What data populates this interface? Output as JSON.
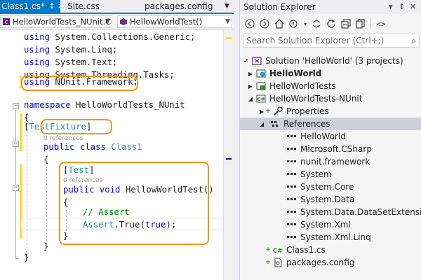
{
  "editor": {
    "tabs": [
      {
        "label": "Class1.cs*",
        "active": true
      },
      {
        "label": "Site.css",
        "active": false
      },
      {
        "label": "packages.config",
        "active": false
      }
    ],
    "navbar": {
      "project": "HelloWorldTests_NUnit.C",
      "member": "HellowWorldTest()"
    },
    "code": [
      {
        "parts": [
          [
            "kw",
            "using"
          ],
          [
            "",
            "System.Collections.Generic;"
          ]
        ]
      },
      {
        "parts": [
          [
            "kw",
            "using"
          ],
          [
            "",
            "System.Linq;"
          ]
        ]
      },
      {
        "parts": [
          [
            "kw",
            "using"
          ],
          [
            "",
            "System.Text;"
          ]
        ]
      },
      {
        "parts": [
          [
            "kw",
            "using"
          ],
          [
            "",
            "System.Threading.Tasks;"
          ]
        ]
      },
      {
        "parts": [
          [
            "kw",
            "using"
          ],
          [
            "",
            "NUnit.Framework;"
          ]
        ]
      },
      {
        "parts": []
      },
      {
        "parts": [
          [
            "kw",
            "namespace"
          ],
          [
            "",
            "HelloWorldTests_NUnit"
          ]
        ]
      },
      {
        "parts": [
          [
            "",
            "{"
          ]
        ]
      },
      {
        "parts": [
          [
            "",
            "["
          ],
          [
            "ty",
            "TestFixture"
          ],
          [
            "",
            "]"
          ]
        ]
      },
      {
        "parts": [
          [
            "kw",
            "public"
          ],
          [
            "kw",
            "class"
          ],
          [
            "ty",
            "Class1"
          ]
        ]
      },
      {
        "parts": [
          [
            "",
            "{"
          ]
        ]
      },
      {
        "parts": [
          [
            "",
            "["
          ],
          [
            "ty",
            "Test"
          ],
          [
            "",
            "]"
          ]
        ]
      },
      {
        "parts": [
          [
            "kw",
            "public"
          ],
          [
            "kw",
            "void"
          ],
          [
            "",
            "HellowWorldTest()"
          ]
        ]
      },
      {
        "parts": [
          [
            "",
            "{"
          ]
        ]
      },
      {
        "parts": [
          [
            "cm",
            "// Assert"
          ]
        ]
      },
      {
        "parts": [
          [
            "ty",
            "Assert"
          ],
          [
            "",
            ".True("
          ],
          [
            "kw",
            "true"
          ],
          [
            "",
            ");"
          ]
        ]
      },
      {
        "parts": [
          [
            "",
            "}"
          ]
        ]
      },
      {
        "parts": [
          [
            "",
            "}"
          ]
        ]
      },
      {
        "parts": [
          [
            "",
            "}"
          ]
        ]
      }
    ],
    "lens_class": "0 references",
    "lens_method": "0 references"
  },
  "solution_explorer": {
    "title": "Solution Explorer",
    "search_placeholder": "Search Solution Explorer (Ctrl+;)",
    "tree": [
      {
        "label": "Solution 'HelloWorld' (3 projects)",
        "icon": "solution-icon",
        "bold": false
      },
      {
        "label": "HelloWorld",
        "icon": "web-project-icon",
        "bold": true
      },
      {
        "label": "HelloWorldTests",
        "icon": "test-project-icon",
        "bold": false
      },
      {
        "label": "HelloWorldTests-NUnit",
        "icon": "csharp-project-icon",
        "bold": false
      },
      {
        "label": "Properties",
        "icon": "wrench-icon",
        "bold": false
      },
      {
        "label": "References",
        "icon": "references-icon",
        "bold": false
      },
      {
        "label": "HelloWorld",
        "icon": "reference-icon",
        "bold": false
      },
      {
        "label": "Microsoft.CSharp",
        "icon": "reference-icon",
        "bold": false
      },
      {
        "label": "nunit.framework",
        "icon": "reference-icon",
        "bold": false
      },
      {
        "label": "System",
        "icon": "reference-icon",
        "bold": false
      },
      {
        "label": "System.Core",
        "icon": "reference-icon",
        "bold": false
      },
      {
        "label": "System.Data",
        "icon": "reference-icon",
        "bold": false
      },
      {
        "label": "System.Data.DataSetExtensions",
        "icon": "reference-icon",
        "bold": false
      },
      {
        "label": "System.Xml",
        "icon": "reference-icon",
        "bold": false
      },
      {
        "label": "System.Xml.Linq",
        "icon": "reference-icon",
        "bold": false
      },
      {
        "label": "Class1.cs",
        "icon": "csharp-file-icon",
        "bold": false
      },
      {
        "label": "packages.config",
        "icon": "config-file-icon",
        "bold": false
      }
    ]
  },
  "colors": {
    "accent": "#007ACC",
    "highlight_box": "#F0961E",
    "keyword": "#0000FF",
    "type": "#2B91AF",
    "comment": "#008000",
    "change_bar": "#F3E13D"
  }
}
